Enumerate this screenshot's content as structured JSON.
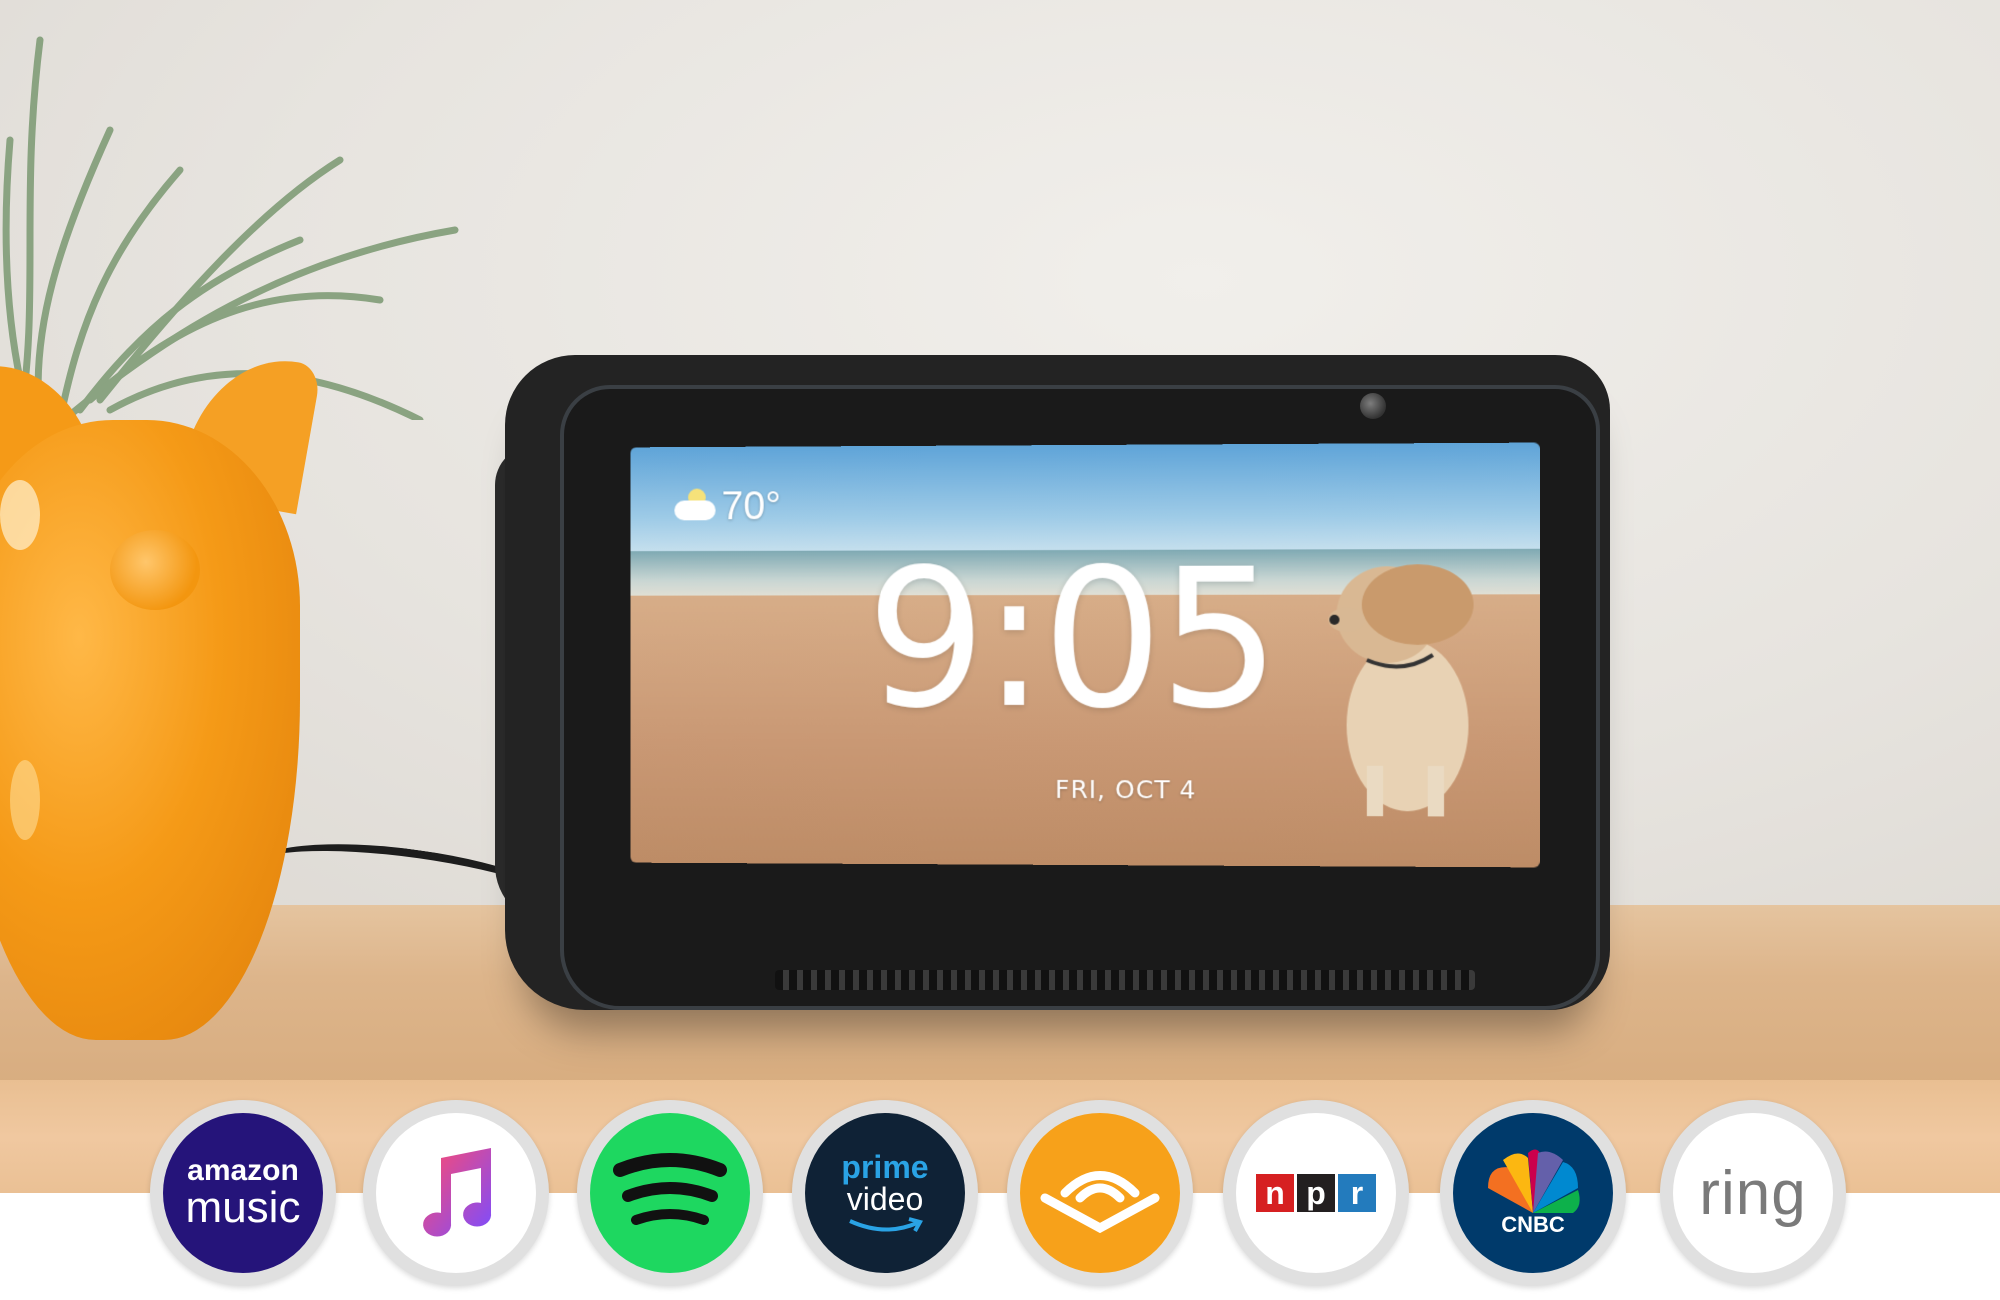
{
  "device_screen": {
    "temperature": "70°",
    "time": "9:05",
    "date": "FRI, OCT 4",
    "weather_icon": "partly-cloudy-icon"
  },
  "services": [
    {
      "name": "amazon-music",
      "line1": "amazon",
      "line2": "music",
      "color": "#25147a"
    },
    {
      "name": "apple-music",
      "icon": "music-note-icon",
      "color": "#ffffff"
    },
    {
      "name": "spotify",
      "icon": "spotify-waves-icon",
      "color": "#1ed760"
    },
    {
      "name": "prime-video",
      "line1": "prime",
      "line2": "video",
      "color": "#0f2236"
    },
    {
      "name": "audible",
      "icon": "audible-icon",
      "color": "#f7a11a"
    },
    {
      "name": "npr",
      "letters": [
        "n",
        "p",
        "r"
      ],
      "colors": [
        "#d62021",
        "#231f20",
        "#237bbd"
      ]
    },
    {
      "name": "cnbc",
      "label": "CNBC",
      "color": "#003a6b"
    },
    {
      "name": "ring",
      "label": "ring",
      "color": "#ffffff"
    }
  ]
}
